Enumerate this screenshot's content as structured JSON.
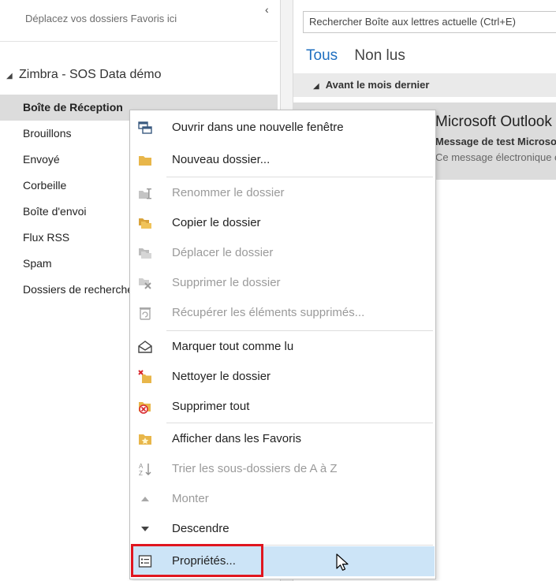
{
  "folder_pane": {
    "favorites_hint": "Déplacez vos dossiers Favoris ici",
    "collapse_glyph": "‹",
    "account_expand_glyph": "◢",
    "account_name": "Zimbra - SOS Data démo",
    "folders": [
      {
        "label": "Boîte de Réception",
        "selected": true
      },
      {
        "label": "Brouillons"
      },
      {
        "label": "Envoyé"
      },
      {
        "label": "Corbeille"
      },
      {
        "label": "Boîte d'envoi"
      },
      {
        "label": "Flux RSS"
      },
      {
        "label": "Spam"
      },
      {
        "label": "Dossiers de recherche"
      }
    ]
  },
  "mail_pane": {
    "search_placeholder": "Rechercher Boîte aux lettres actuelle (Ctrl+E)",
    "tabs": [
      "Tous",
      "Non lus"
    ],
    "group_expand_glyph": "◢",
    "group_header": "Avant le mois dernier",
    "message": {
      "sender": "Microsoft Outlook",
      "subject": "Message de test Microsoft Outlook",
      "preview": "Ce message électronique est envoyé automatiquement"
    }
  },
  "context_menu": {
    "items": [
      {
        "id": "open-new-window",
        "label": "Ouvrir dans une nouvelle fenêtre",
        "icon": "new-window-icon",
        "enabled": true
      },
      {
        "id": "new-folder",
        "label": "Nouveau dossier...",
        "icon": "folder-icon",
        "enabled": true
      },
      {
        "id": "rename-folder",
        "label": "Renommer le dossier",
        "icon": "rename-icon",
        "enabled": false
      },
      {
        "id": "copy-folder",
        "label": "Copier le dossier",
        "icon": "copy-folder-icon",
        "enabled": true
      },
      {
        "id": "move-folder",
        "label": "Déplacer le dossier",
        "icon": "move-folder-icon",
        "enabled": false
      },
      {
        "id": "delete-folder",
        "label": "Supprimer le dossier",
        "icon": "delete-folder-icon",
        "enabled": false
      },
      {
        "id": "recover-deleted",
        "label": "Récupérer les éléments supprimés...",
        "icon": "recover-icon",
        "enabled": false
      },
      {
        "id": "mark-all-read",
        "label": "Marquer tout comme lu",
        "icon": "open-envelope-icon",
        "enabled": true
      },
      {
        "id": "clean-folder",
        "label": "Nettoyer le dossier",
        "icon": "clean-folder-icon",
        "enabled": true
      },
      {
        "id": "delete-all",
        "label": "Supprimer tout",
        "icon": "delete-all-icon",
        "enabled": true
      },
      {
        "id": "show-in-favorites",
        "label": "Afficher dans les Favoris",
        "icon": "star-folder-icon",
        "enabled": true
      },
      {
        "id": "sort-subfolders",
        "label": "Trier les sous-dossiers de A à Z",
        "icon": "sort-az-icon",
        "enabled": false
      },
      {
        "id": "move-up",
        "label": "Monter",
        "icon": "arrow-up-icon",
        "enabled": false
      },
      {
        "id": "move-down",
        "label": "Descendre",
        "icon": "arrow-down-icon",
        "enabled": true
      },
      {
        "id": "properties",
        "label": "Propriétés...",
        "icon": "properties-icon",
        "enabled": true,
        "hovered": true,
        "highlighted": true
      }
    ]
  },
  "colors": {
    "accent_tab": "#1f6fc0",
    "hover_bg": "#cce4f7",
    "highlight_border": "#e0161f",
    "selected_folder_bg": "#dcdcdc",
    "folder_icon": "#e8b64a"
  }
}
